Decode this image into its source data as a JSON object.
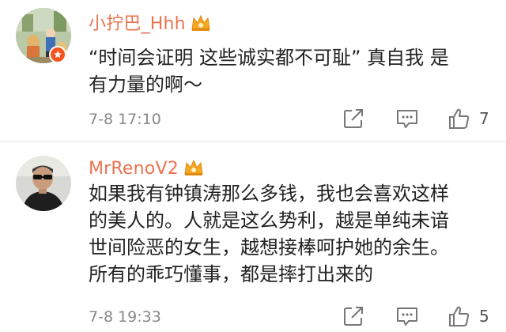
{
  "comments": [
    {
      "username": "小拧巴_Hhh",
      "lines": [
        "“时间会证明 这些诚实都不可耻” 真自我 是",
        "有力量的啊～"
      ],
      "time": "7-8 17:10",
      "likes": "7",
      "icons": {
        "avatar": "avatar-photo",
        "badge": "verified-v-icon",
        "crown": "crown-icon"
      }
    },
    {
      "username": "MrRenoV2",
      "lines": [
        "如果我有钟镇涛那么多钱，我也会喜欢这样",
        "的美人的。人就是这么势利，越是单纯未谙",
        "世间险恶的女生，越想接棒呵护她的余生。",
        "所有的乖巧懂事，都是摔打出来的"
      ],
      "time": "7-8 19:33",
      "likes": "5",
      "icons": {
        "avatar": "avatar-photo",
        "crown": "crown-icon"
      }
    }
  ],
  "colors": {
    "username": "#eb7350",
    "text": "#222222",
    "meta": "#888888",
    "badge": "#f5521c",
    "crown": "#f5a623"
  }
}
